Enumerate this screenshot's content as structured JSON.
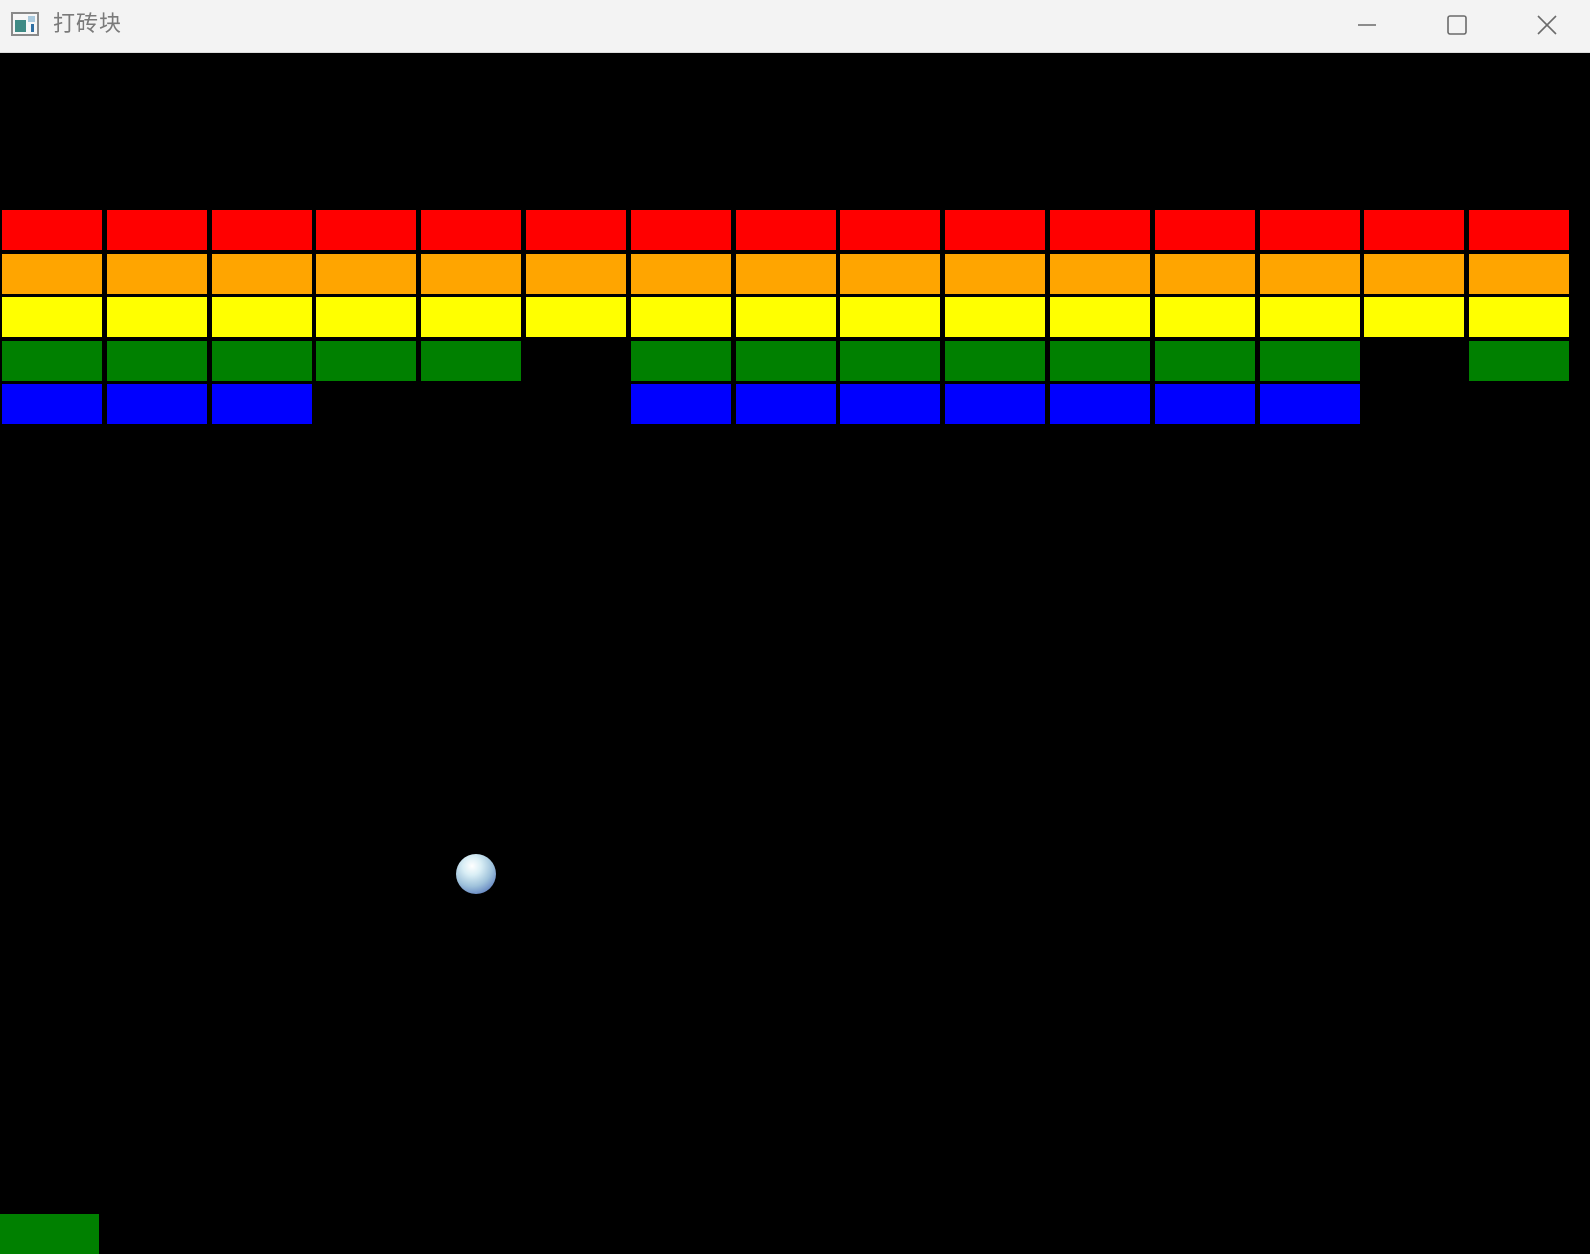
{
  "window": {
    "title": "打砖块",
    "icon": "app-window-icon",
    "controls": {
      "minimize": "minimize-icon",
      "maximize": "maximize-icon",
      "close": "close-icon"
    }
  },
  "game": {
    "background": "#000000",
    "columns": 15,
    "rows": [
      {
        "color": "#ff0000",
        "present": [
          1,
          1,
          1,
          1,
          1,
          1,
          1,
          1,
          1,
          1,
          1,
          1,
          1,
          1,
          1
        ]
      },
      {
        "color": "#ffa500",
        "present": [
          1,
          1,
          1,
          1,
          1,
          1,
          1,
          1,
          1,
          1,
          1,
          1,
          1,
          1,
          1
        ]
      },
      {
        "color": "#ffff00",
        "present": [
          1,
          1,
          1,
          1,
          1,
          1,
          1,
          1,
          1,
          1,
          1,
          1,
          1,
          1,
          1
        ]
      },
      {
        "color": "#008000",
        "present": [
          1,
          1,
          1,
          1,
          1,
          0,
          1,
          1,
          1,
          1,
          1,
          1,
          1,
          0,
          1
        ]
      },
      {
        "color": "#0000ff",
        "present": [
          1,
          1,
          1,
          0,
          0,
          0,
          1,
          1,
          1,
          1,
          1,
          1,
          1,
          0,
          0
        ]
      }
    ],
    "ball": {
      "colors": [
        "#ffffff",
        "#9fc2db",
        "#3a55a8"
      ]
    },
    "paddle": {
      "color": "#008000"
    }
  }
}
